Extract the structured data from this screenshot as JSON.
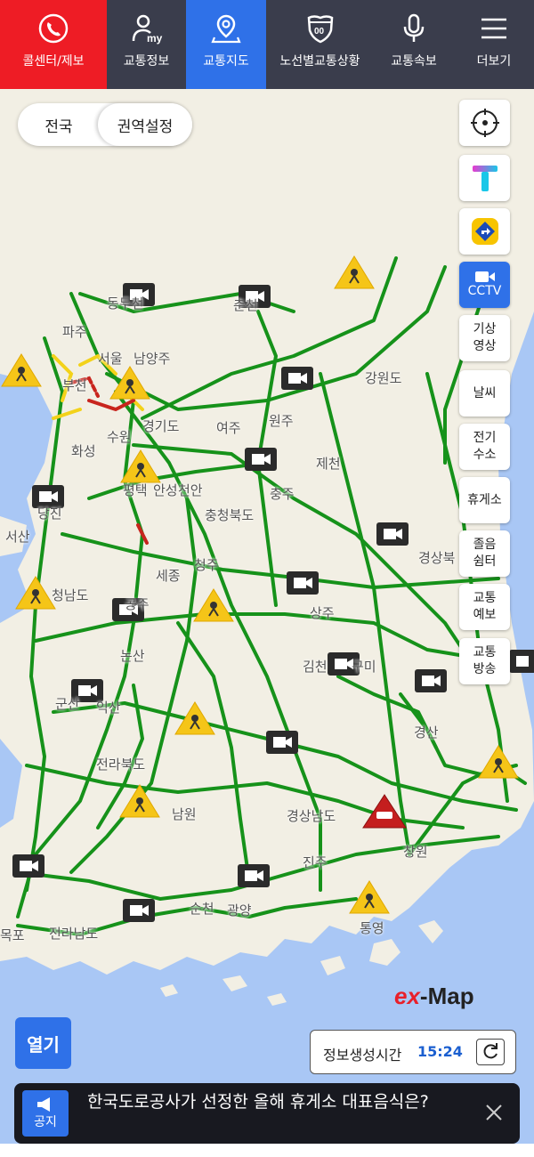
{
  "nav": {
    "call": "콜센터/제보",
    "myinfo_icon_text": "my",
    "traffic_info": "교통정보",
    "traffic_map": "교통지도",
    "route_status": "노선별교통상황",
    "route_icon_text": "00",
    "traffic_news": "교통속보",
    "more": "더보기"
  },
  "region_toggle": {
    "nationwide": "전국",
    "region_setting": "권역설정"
  },
  "side": {
    "location": "location-target-icon",
    "tmap": "T",
    "cctv": "CCTV",
    "weather_video": [
      "기상",
      "영상"
    ],
    "weather": "날씨",
    "ev_hydrogen": [
      "전기",
      "수소"
    ],
    "rest_area": "휴게소",
    "drowsy_shelter": [
      "졸음",
      "쉼터"
    ],
    "traffic_forecast": [
      "교통",
      "예보"
    ],
    "traffic_broadcast": [
      "교통",
      "방송"
    ]
  },
  "map_labels": [
    "동두천",
    "파주",
    "서울",
    "남양주",
    "춘천",
    "강원도",
    "원주",
    "부천",
    "경기도",
    "여주",
    "화성",
    "수원",
    "제천",
    "평택",
    "안성",
    "충주",
    "당진",
    "충청북도",
    "서산",
    "세종",
    "청주",
    "경상북",
    "청남도",
    "논산",
    "상주",
    "김천",
    "구미",
    "군산",
    "익산",
    "경산",
    "전라북도",
    "남원",
    "경상남도",
    "창원",
    "진주",
    "순천",
    "광양",
    "통영",
    "전라남도",
    "목포",
    "공주",
    "천안"
  ],
  "colors": {
    "flow_smooth": "#16921a",
    "flow_slow": "#f3d21a",
    "flow_congested": "#c8251e",
    "land": "#f2efe4",
    "sea": "#a9c7f5",
    "active_blue": "#2f71e8"
  },
  "logo": {
    "ex": "ex",
    "map": "-Map"
  },
  "open_button": "열기",
  "info_time": {
    "label": "정보생성시간",
    "value": "15:24"
  },
  "notice": {
    "badge": "공지",
    "text": "한국도로공사가 선정한 올해 휴게소 대표음식은?"
  }
}
